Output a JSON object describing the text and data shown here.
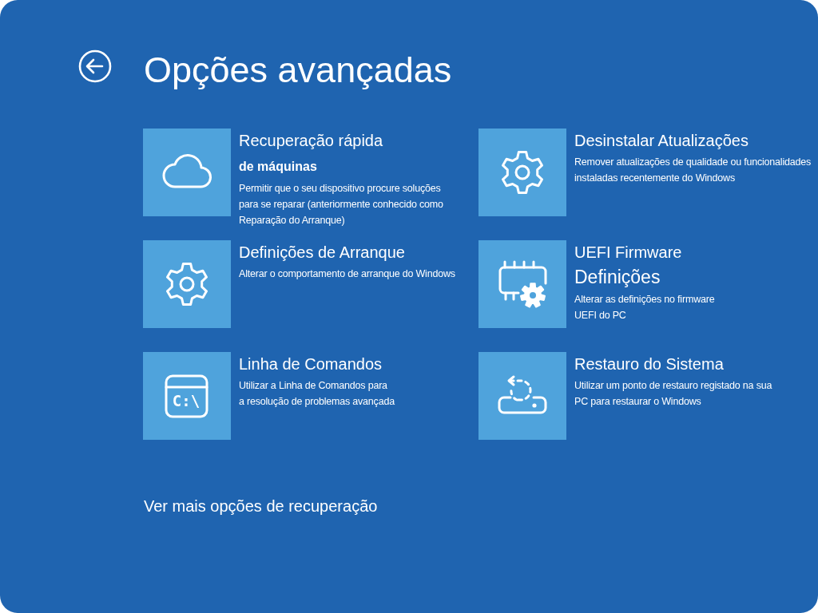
{
  "header": {
    "title": "Opções avançadas"
  },
  "options": [
    {
      "title_lines": [
        {
          "text": "Recuperação rápida",
          "kind": "heading"
        },
        {
          "text": "de máquinas",
          "kind": "subheading"
        }
      ],
      "description_lines": [
        "Permitir que o seu dispositivo procure soluções",
        "para se reparar (anteriormente conhecido como",
        "Reparação do Arranque)"
      ]
    },
    {
      "title_lines": [
        {
          "text": "Desinstalar Atualizações",
          "kind": "heading"
        }
      ],
      "description_lines": [
        "Remover atualizações de qualidade ou funcionalidades",
        "instaladas recentemente do Windows"
      ]
    },
    {
      "title_lines": [
        {
          "text": "Definições de Arranque",
          "kind": "heading"
        }
      ],
      "description_lines": [
        "Alterar o comportamento de arranque do Windows"
      ]
    },
    {
      "title_lines": [
        {
          "text": "UEFI Firmware",
          "kind": "heading"
        },
        {
          "text": "Definições",
          "kind": "large"
        }
      ],
      "description_lines": [
        "Alterar as definições no firmware",
        "UEFI do PC"
      ]
    },
    {
      "title_lines": [
        {
          "text": "Linha de Comandos",
          "kind": "heading"
        }
      ],
      "description_lines": [
        "Utilizar a Linha de Comandos para",
        "a resolução de problemas avançada"
      ],
      "icon_text": "C:\\"
    },
    {
      "title_lines": [
        {
          "text": "Restauro do Sistema",
          "kind": "heading"
        }
      ],
      "description_lines": [
        "Utilizar um ponto de restauro registado na sua",
        "PC para restaurar o Windows"
      ]
    }
  ],
  "more_link": "Ver mais opções de recuperação"
}
